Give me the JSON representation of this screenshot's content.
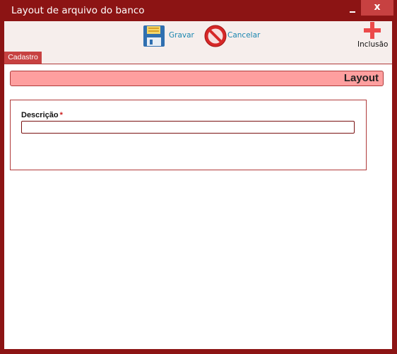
{
  "window": {
    "title": "Layout de arquivo do banco",
    "minimize_icon": "minimize-icon",
    "close_label": "x"
  },
  "toolbar": {
    "save_label": "Gravar",
    "save_icon": "floppy-disk-icon",
    "cancel_label": "Cancelar",
    "cancel_icon": "no-entry-icon",
    "new_label": "Inclusão",
    "new_icon": "plus-icon"
  },
  "tabs": [
    {
      "label": "Cadastro",
      "active": true
    }
  ],
  "section": {
    "title": "Layout"
  },
  "form": {
    "description_label": "Descrição",
    "required_marker": "*",
    "description_value": "",
    "description_placeholder": ""
  },
  "colors": {
    "frame": "#8c1414",
    "close_button": "#c74141",
    "toolbar_bg": "#f6eeec",
    "tab_bg": "#c74141",
    "section_header_bg": "#fe9f9f",
    "link_text": "#1a86b0",
    "required": "#cc1f1f"
  }
}
